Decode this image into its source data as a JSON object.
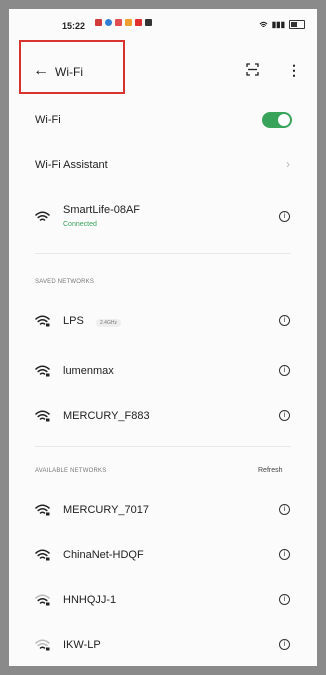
{
  "status_bar": {
    "time": "15:22",
    "signal": "▮▮▮"
  },
  "app_bar": {
    "title": "Wi-Fi",
    "back_icon": "arrow-left-icon",
    "scan_icon": "qr-scan-icon",
    "more_icon": "more-vertical-icon"
  },
  "wifi_toggle": {
    "label": "Wi-Fi",
    "on": true
  },
  "assistant": {
    "label": "Wi-Fi Assistant"
  },
  "connected": {
    "name": "SmartLife-08AF",
    "status": "Connected"
  },
  "saved": {
    "header": "SAVED NETWORKS",
    "items": [
      {
        "name": "LPS",
        "badge": "2.4GHz"
      },
      {
        "name": "lumenmax"
      },
      {
        "name": "MERCURY_F883"
      }
    ]
  },
  "available": {
    "header": "AVAILABLE NETWORKS",
    "refresh": "Refresh",
    "items": [
      {
        "name": "MERCURY_7017"
      },
      {
        "name": "ChinaNet-HDQF"
      },
      {
        "name": "HNHQJJ-1"
      },
      {
        "name": "IKW-LP"
      }
    ]
  },
  "colors": {
    "accent": "#3aa35b",
    "highlight": "#d9332f"
  }
}
